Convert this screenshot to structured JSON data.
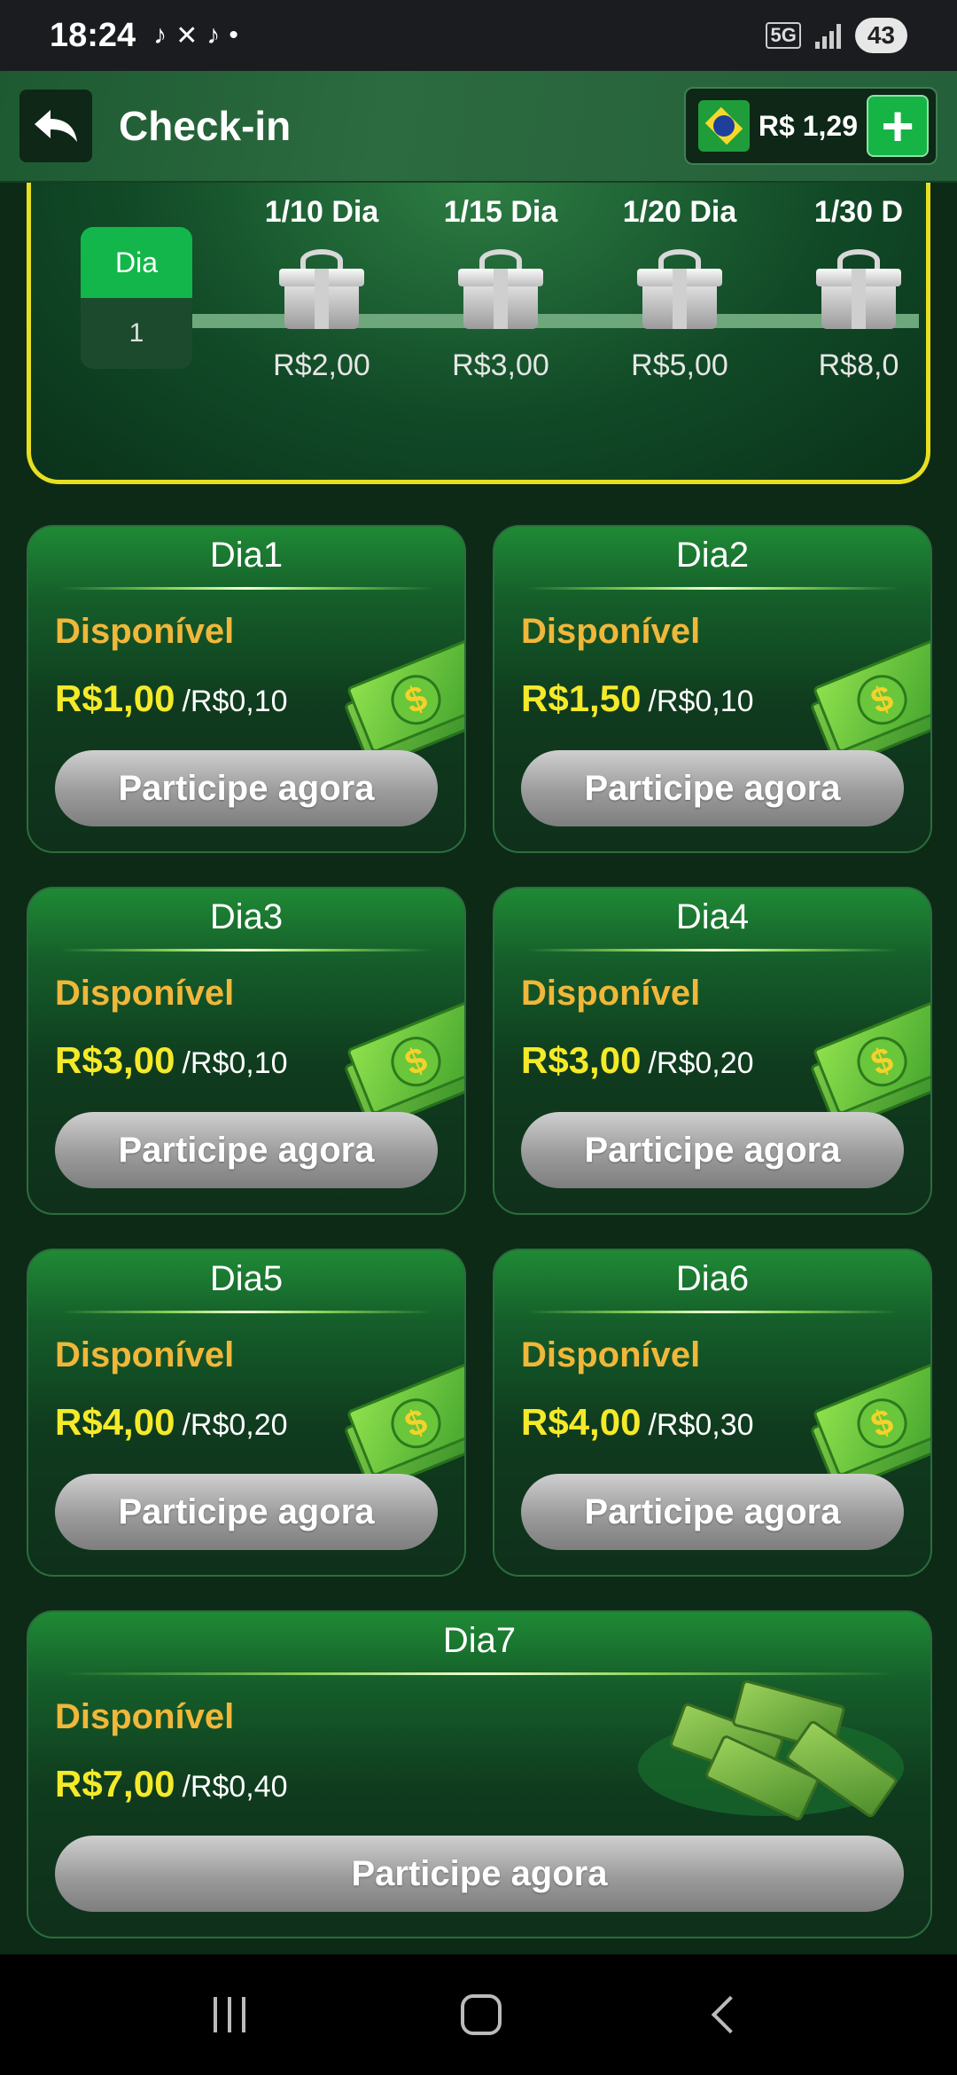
{
  "status_bar": {
    "time": "18:24",
    "network": "5G",
    "battery": "43"
  },
  "header": {
    "title": "Check-in",
    "balance": "R$ 1,29",
    "plus_symbol": "+"
  },
  "progress": {
    "day_label": "Dia",
    "day_value": "1",
    "milestones": [
      {
        "title": "1/10 Dia",
        "value": "R$2,00"
      },
      {
        "title": "1/15 Dia",
        "value": "R$3,00"
      },
      {
        "title": "1/20 Dia",
        "value": "R$5,00"
      },
      {
        "title": "1/30 D",
        "value": "R$8,0"
      }
    ]
  },
  "cards": [
    {
      "day": "Dia1",
      "status": "Disponível",
      "reward": "R$1,00",
      "cost": "/R$0,10",
      "button": "Participe agora"
    },
    {
      "day": "Dia2",
      "status": "Disponível",
      "reward": "R$1,50",
      "cost": "/R$0,10",
      "button": "Participe agora"
    },
    {
      "day": "Dia3",
      "status": "Disponível",
      "reward": "R$3,00",
      "cost": "/R$0,10",
      "button": "Participe agora"
    },
    {
      "day": "Dia4",
      "status": "Disponível",
      "reward": "R$3,00",
      "cost": "/R$0,20",
      "button": "Participe agora"
    },
    {
      "day": "Dia5",
      "status": "Disponível",
      "reward": "R$4,00",
      "cost": "/R$0,20",
      "button": "Participe agora"
    },
    {
      "day": "Dia6",
      "status": "Disponível",
      "reward": "R$4,00",
      "cost": "/R$0,30",
      "button": "Participe agora"
    },
    {
      "day": "Dia7",
      "status": "Disponível",
      "reward": "R$7,00",
      "cost": "/R$0,40",
      "button": "Participe agora"
    }
  ],
  "icons": {
    "back": "back-arrow-icon",
    "flag": "brazil-flag-icon",
    "gift": "gift-box-icon",
    "cash": "cash-bills-icon",
    "cash_stack": "cash-stack-icon"
  }
}
